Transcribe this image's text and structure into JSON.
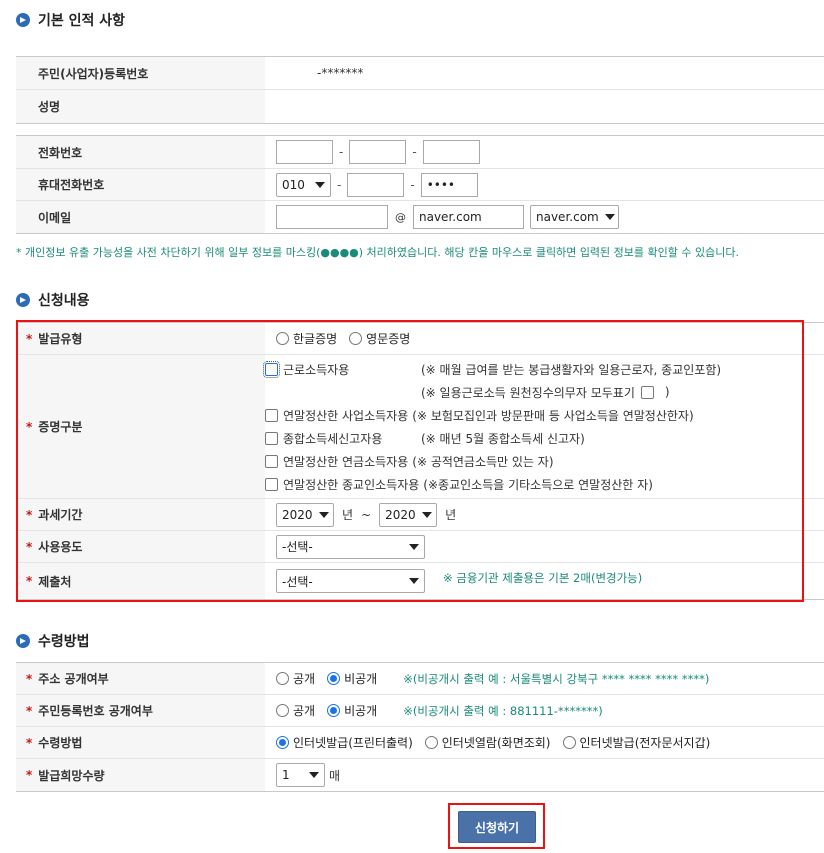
{
  "sections": {
    "basic": "기본 인적 사항",
    "request": "신청내용",
    "receive": "수령방법"
  },
  "basic": {
    "id_label": "주민(사업자)등록번호",
    "id_value": "-*******",
    "name_label": "성명",
    "name_value": ""
  },
  "contact": {
    "phone_label": "전화번호",
    "phone_1": "",
    "phone_2": "",
    "phone_3": "",
    "mobile_label": "휴대전화번호",
    "mobile_prefix": "010",
    "mobile_2": "",
    "mobile_3": "••••",
    "email_label": "이메일",
    "email_id": "",
    "email_at": "@",
    "email_domain": "naver.com",
    "email_domain_select": "naver.com"
  },
  "mask_note": "* 개인정보 유출 가능성을 사전 차단하기 위해 일부 정보를 마스킹(●●●●) 처리하였습니다. 해당 칸을 마우스로 클릭하면 입력된 정보를 확인할 수 있습니다.",
  "request": {
    "issue_type_label": "발급유형",
    "issue_type_options": [
      "한글증명",
      "영문증명"
    ],
    "cert_label": "증명구분",
    "cert_items": [
      {
        "label": "근로소득자용",
        "note": "(※ 매월 급여를 받는 봉급생활자와 일용근로자, 종교인포함)"
      },
      {
        "label": "",
        "note": "(※ 일용근로소득 원천징수의무자 모두표기"
      },
      {
        "label": "연말정산한 사업소득자용",
        "note": "(※ 보험모집인과 방문판매 등 사업소득을 연말정산한자)"
      },
      {
        "label": "종합소득세신고자용",
        "note": "(※ 매년 5월 종합소득세 신고자)"
      },
      {
        "label": "연말정산한 연금소득자용",
        "note": "(※ 공적연금소득만 있는 자)"
      },
      {
        "label": "연말정산한 종교인소득자용",
        "note": "(※종교인소득을 기타소득으로 연말정산한 자)"
      }
    ],
    "cert_note_close": ")",
    "period_label": "과세기간",
    "period_from": "2020",
    "period_from_unit": "년",
    "period_sep": "~",
    "period_to": "2020",
    "period_to_unit": "년",
    "usage_label": "사용용도",
    "usage_value": "-선택-",
    "submit_label": "제출처",
    "submit_value": "-선택-",
    "submit_note": "※ 금융기관 제출용은 기본 2매(변경가능)"
  },
  "receive": {
    "addr_label": "주소 공개여부",
    "addr_options": [
      "공개",
      "비공개"
    ],
    "addr_selected": 1,
    "addr_note": "※(비공개시 출력 예 : 서울특별시 강북구 **** **** **** ****)",
    "rrn_label": "주민등록번호 공개여부",
    "rrn_options": [
      "공개",
      "비공개"
    ],
    "rrn_selected": 1,
    "rrn_note": "※(비공개시 출력 예 : 881111-*******)",
    "method_label": "수령방법",
    "method_options": [
      "인터넷발급(프린터출력)",
      "인터넷열람(화면조회)",
      "인터넷발급(전자문서지갑)"
    ],
    "method_selected": 0,
    "qty_label": "발급희망수량",
    "qty_value": "1",
    "qty_unit": "매"
  },
  "submit_button": "신청하기",
  "colors": {
    "accent": "#2b6cb8",
    "required": "#c41818",
    "note": "#1a8a7a",
    "highlight_box": "#e11111",
    "button": "#4a72a8"
  }
}
